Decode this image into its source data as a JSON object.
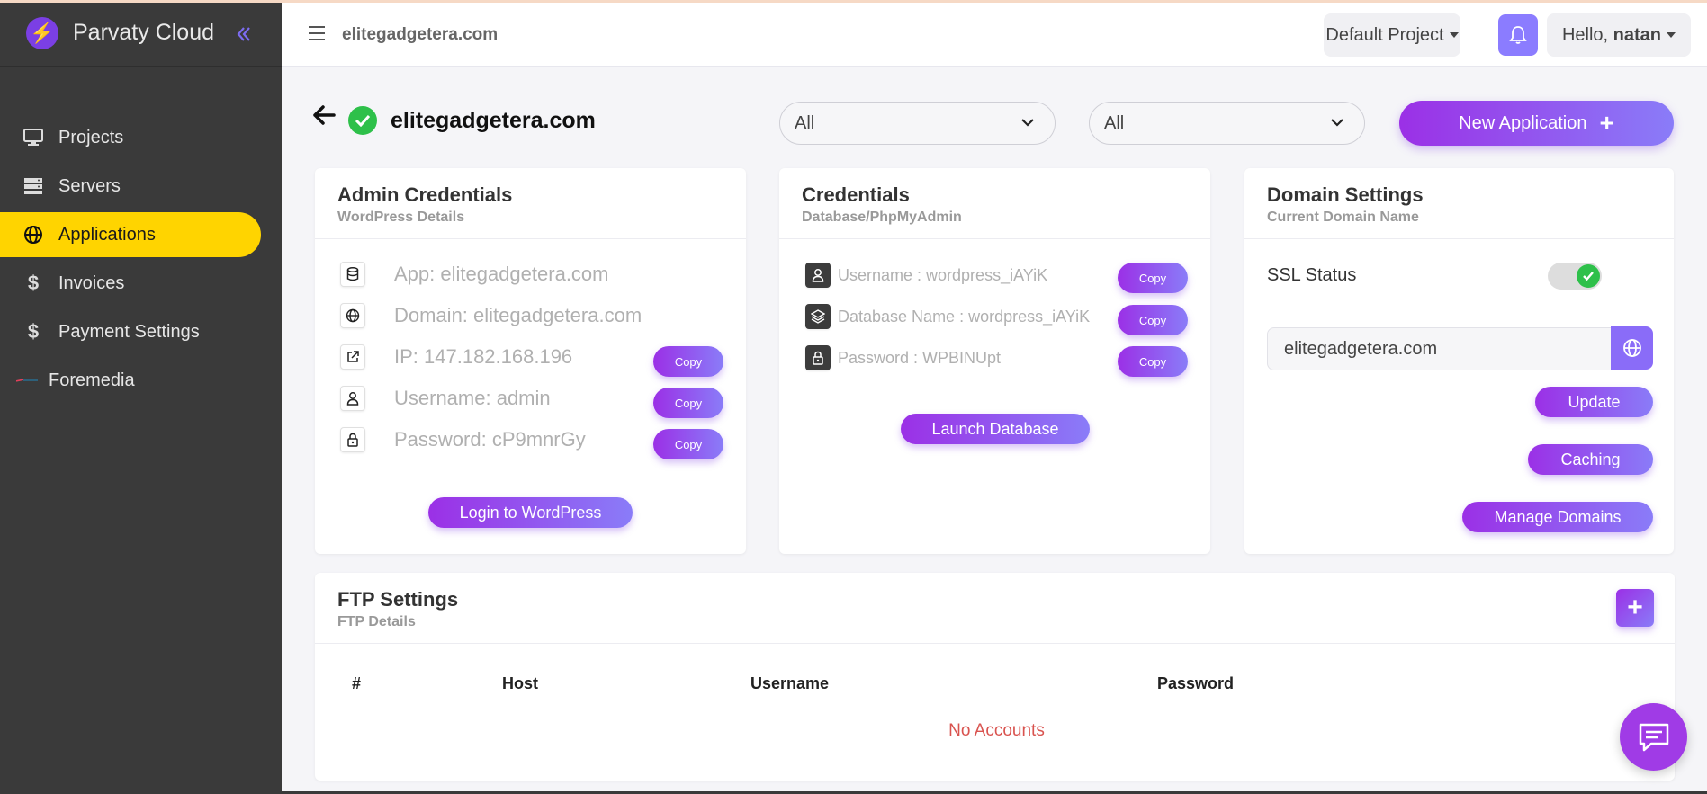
{
  "brand": {
    "name": "Parvaty Cloud"
  },
  "sidebar": {
    "items": [
      {
        "label": "Projects",
        "icon": "monitor-icon"
      },
      {
        "label": "Servers",
        "icon": "server-icon"
      },
      {
        "label": "Applications",
        "icon": "globe-icon",
        "active": true
      },
      {
        "label": "Invoices",
        "icon": "dollar-icon"
      },
      {
        "label": "Payment Settings",
        "icon": "dollar-icon"
      },
      {
        "label": "Foremedia",
        "icon": "image-icon"
      }
    ]
  },
  "header": {
    "domain": "elitegadgetera.com",
    "project_label": "Default Project",
    "hello_prefix": "Hello,",
    "user": "natan"
  },
  "page": {
    "title": "elitegadgetera.com",
    "filter1": "All",
    "filter2": "All",
    "new_app_label": "New Application"
  },
  "admin": {
    "title": "Admin Credentials",
    "subtitle": "WordPress Details",
    "app": "App: elitegadgetera.com",
    "domain": "Domain: elitegadgetera.com",
    "ip": "IP: 147.182.168.196",
    "username": "Username: admin",
    "password": "Password: cP9mnrGy",
    "copy_label": "Copy",
    "login_label": "Login to WordPress"
  },
  "db": {
    "title": "Credentials",
    "subtitle": "Database/PhpMyAdmin",
    "username": "Username : wordpress_iAYiK",
    "dbname": "Database Name : wordpress_iAYiK",
    "password": "Password : WPBINUpt",
    "copy_label": "Copy",
    "launch_label": "Launch Database"
  },
  "domain_settings": {
    "title": "Domain Settings",
    "subtitle": "Current Domain Name",
    "ssl_label": "SSL Status",
    "ssl_enabled": true,
    "domain_value": "elitegadgetera.com",
    "update_label": "Update",
    "caching_label": "Caching",
    "manage_label": "Manage Domains"
  },
  "ftp": {
    "title": "FTP Settings",
    "subtitle": "FTP Details",
    "columns": [
      "#",
      "Host",
      "Username",
      "Password"
    ],
    "empty_text": "No Accounts"
  },
  "colors": {
    "accent": "#9b30e6",
    "active_nav": "#ffd400",
    "sidebar_bg": "#3a3a3a",
    "success": "#2ec04a",
    "danger": "#d9534f"
  }
}
